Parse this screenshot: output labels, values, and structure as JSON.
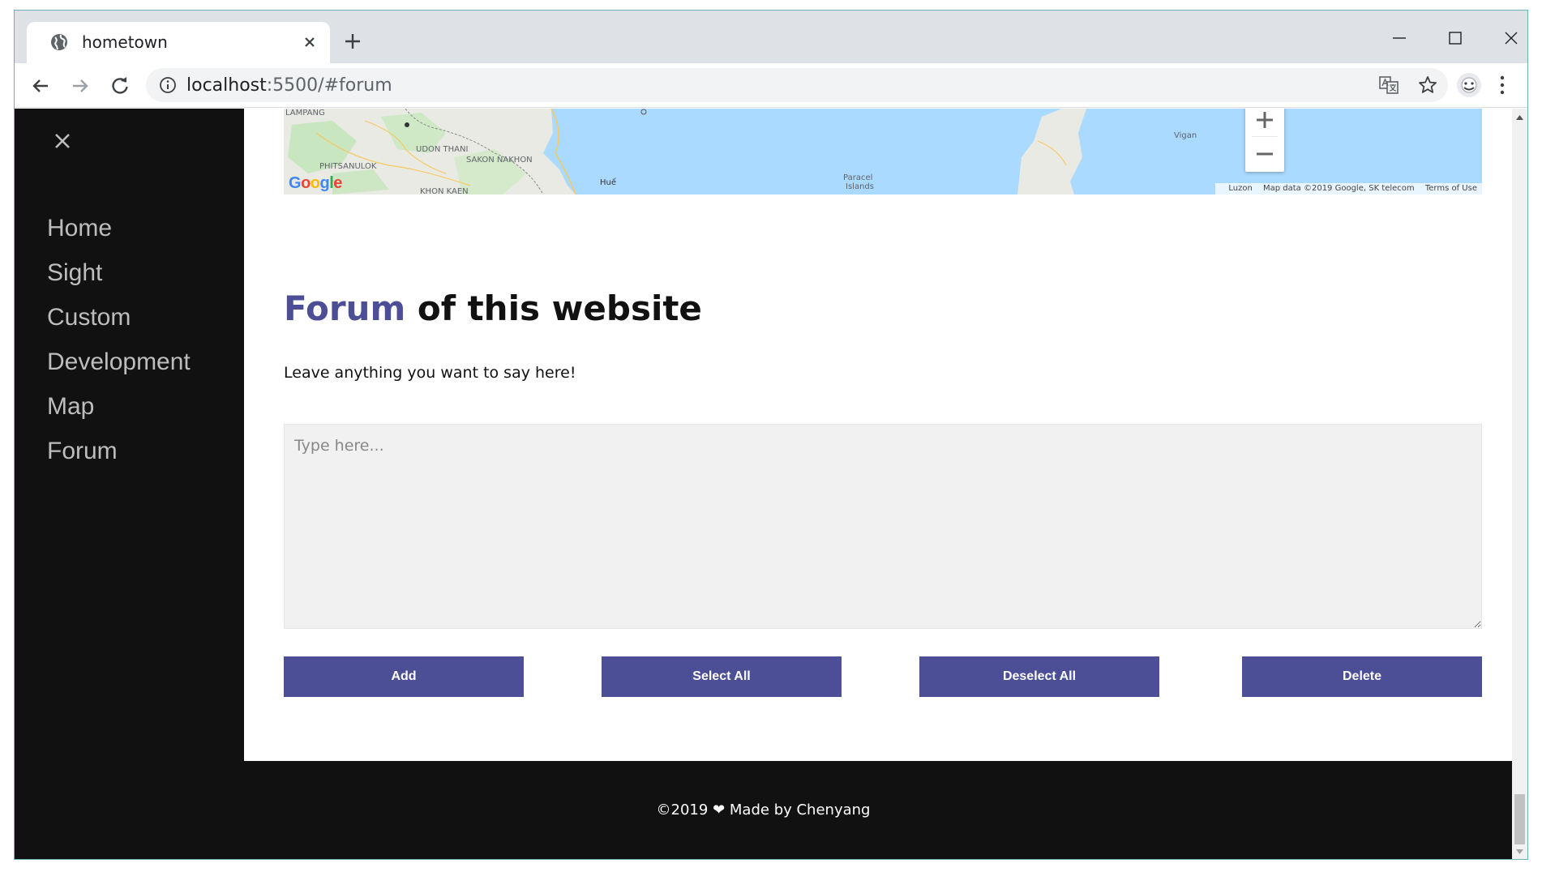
{
  "browser": {
    "tab_title": "hometown",
    "url_host": "localhost",
    "url_rest": ":5500/#forum"
  },
  "sidebar": {
    "items": [
      {
        "label": "Home"
      },
      {
        "label": "Sight"
      },
      {
        "label": "Custom"
      },
      {
        "label": "Development"
      },
      {
        "label": "Map"
      },
      {
        "label": "Forum"
      }
    ]
  },
  "map": {
    "labels": [
      "LAMPANG",
      "UDON THANI",
      "SAKON NAKHON",
      "PHITSANULOK",
      "KHON KAEN",
      "Huế",
      "Paracel",
      "Islands",
      "Vigan",
      "Luzon"
    ],
    "credits": "Map data ©2019 Google, SK telecom",
    "terms": "Terms of Use",
    "logo": "Google"
  },
  "forum": {
    "title_accent": "Forum",
    "title_rest": " of this website",
    "intro": "Leave anything you want to say here!",
    "placeholder": "Type here...",
    "buttons": {
      "add": "Add",
      "select_all": "Select All",
      "deselect_all": "Deselect All",
      "delete": "Delete"
    }
  },
  "footer": {
    "year": "©2019",
    "text": "Made by Chenyang"
  },
  "colors": {
    "accent": "#4d4f96",
    "sidebar_bg": "#111111",
    "map_water": "#aadaff"
  }
}
